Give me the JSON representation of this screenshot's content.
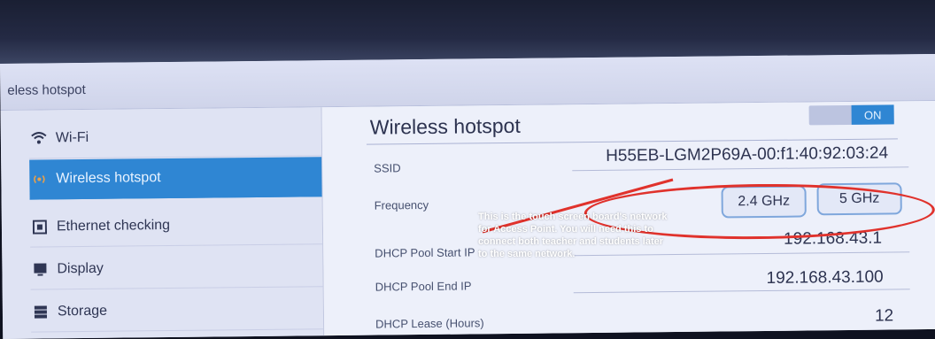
{
  "titlebar": {
    "title": "eless hotspot"
  },
  "sidebar": {
    "items": [
      {
        "label": "Wi-Fi",
        "icon": "wifi-icon"
      },
      {
        "label": "Wireless hotspot",
        "icon": "hotspot-icon"
      },
      {
        "label": "Ethernet checking",
        "icon": "ethernet-icon"
      },
      {
        "label": "Display",
        "icon": "display-icon"
      },
      {
        "label": "Storage",
        "icon": "storage-icon"
      }
    ]
  },
  "main": {
    "title": "Wireless hotspot",
    "toggle_label": "ON",
    "ssid": {
      "label": "SSID",
      "value": "H55EB-LGM2P69A-00:f1:40:92:03:24"
    },
    "frequency": {
      "label": "Frequency",
      "options": [
        "2.4 GHz",
        "5 GHz"
      ]
    },
    "dhcp_start": {
      "label": "DHCP Pool Start IP",
      "value": "192.168.43.1"
    },
    "dhcp_end": {
      "label": "DHCP Pool End IP",
      "value": "192.168.43.100"
    },
    "dhcp_lease": {
      "label": "DHCP Lease (Hours)",
      "value": "12"
    }
  },
  "annotation": {
    "line1": "This is the touch screen board's network",
    "line2": "for Access Point. You will need this to",
    "line3": "connect both teacher and students later",
    "line4": "to the same network."
  },
  "colors": {
    "accent": "#2f86d3",
    "annotation": "#e0322c"
  }
}
